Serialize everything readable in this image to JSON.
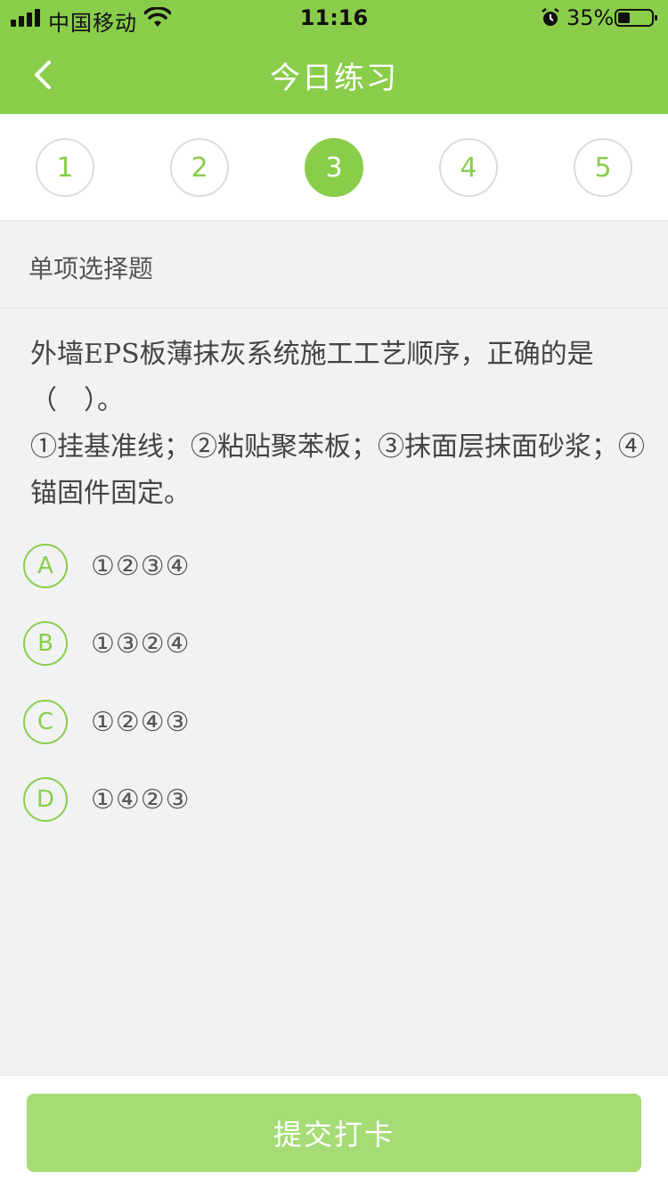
{
  "status_bar": {
    "carrier": "中国移动",
    "time": "11:16",
    "battery_percent": "35%",
    "icons": [
      "signal-icon",
      "wifi-icon",
      "alarm-icon",
      "battery-icon"
    ]
  },
  "nav": {
    "title": "今日练习",
    "back_icon": "chevron-left-icon"
  },
  "steps": {
    "items": [
      "1",
      "2",
      "3",
      "4",
      "5"
    ],
    "active": "3"
  },
  "question_type": "单项选择题",
  "question": {
    "lines": [
      "外墙EPS板薄抹灰系统施工工艺顺序，正确的是",
      "（　）。",
      "①挂基准线；②粘贴聚苯板；③抹面层抹面砂浆；④",
      "锚固件固定。"
    ]
  },
  "options": [
    {
      "letter": "A",
      "text": "①②③④"
    },
    {
      "letter": "B",
      "text": "①③②④"
    },
    {
      "letter": "C",
      "text": "①②④③"
    },
    {
      "letter": "D",
      "text": "①④②③"
    }
  ],
  "footer": {
    "submit_label": "提交打卡"
  },
  "colors": {
    "accent": "#8acd4b",
    "button_disabled": "#a6dc75",
    "background": "#f1f2f4"
  }
}
